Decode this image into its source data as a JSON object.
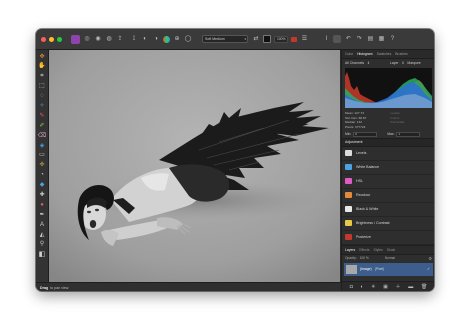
{
  "toolbar": {
    "preset": "Soft Medium",
    "zoom_label": "100%",
    "traffic_colors": [
      "#ff5f57",
      "#febc2e",
      "#28c840"
    ],
    "icons_left": [
      "personas-icon",
      "settings-icon",
      "rgb-icon",
      "share-icon",
      "contrast-icon",
      "color-icon",
      "globe-icon",
      "circle-icon"
    ],
    "icons_right": [
      "brush-icon",
      "undo-icon",
      "redo-icon",
      "arrange-icon",
      "grid-icon",
      "help-icon"
    ]
  },
  "left_tools": [
    "move-icon",
    "crop-icon",
    "selection-icon",
    "lasso-icon",
    "brush-icon",
    "paint-icon",
    "pen-icon",
    "erase-icon",
    "fill-icon",
    "gradient-icon",
    "clone-icon",
    "dodge-icon",
    "burn-icon",
    "sponge-icon",
    "blur-icon",
    "retouch-icon",
    "text-icon",
    "shape-icon",
    "zoom-icon",
    "view-icon"
  ],
  "status": {
    "bold": "Drag",
    "text": "to pan view."
  },
  "panel": {
    "tabs": [
      "Color",
      "Histogram",
      "Swatches",
      "Brushes"
    ],
    "active_tab": "Histogram",
    "channel_select": "All Channels",
    "layer_select": "Layer",
    "marquee_label": "Marquee",
    "stats": [
      {
        "label": "Mean:",
        "value": "127.73",
        "dim": false
      },
      {
        "label": "Levels:",
        "value": "",
        "dim": true
      },
      {
        "label": "Std. Dev:",
        "value": "68.87",
        "dim": false
      },
      {
        "label": "Count:",
        "value": "",
        "dim": true
      },
      {
        "label": "Median:",
        "value": "142",
        "dim": false
      },
      {
        "label": "Percentile:",
        "value": "",
        "dim": true
      },
      {
        "label": "Pixels:",
        "value": "377724",
        "dim": false
      },
      {
        "label": "",
        "value": "",
        "dim": true
      }
    ],
    "min_label": "Min:",
    "min_value": "0",
    "max_label": "Max:",
    "max_value": "1",
    "adjustment_title": "Adjustment",
    "adjustments": [
      {
        "label": "Levels",
        "color": "#dcdcdc"
      },
      {
        "label": "White Balance",
        "color": "#4aa3e0"
      },
      {
        "label": "HSL",
        "color": "#e05cc4"
      },
      {
        "label": "Recolour",
        "color": "#e08a3c"
      },
      {
        "label": "Black & White",
        "color": "#e8e8e8"
      },
      {
        "label": "Brightness / Contrast",
        "color": "#e6c84a"
      },
      {
        "label": "Posterize",
        "color": "#c0392b"
      }
    ],
    "layers_tabs": [
      "Layers",
      "Effects",
      "Styles",
      "Stock"
    ],
    "layers_active": "Layers",
    "opacity_label": "Opacity:",
    "opacity_value": "100 %",
    "blend_label": "Normal",
    "layer_name": "(Image)",
    "layer_type": "(Pixel)"
  }
}
